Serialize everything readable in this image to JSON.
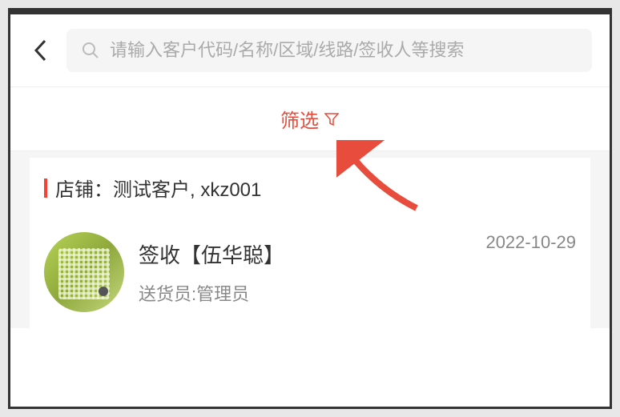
{
  "search": {
    "placeholder": "请输入客户代码/名称/区域/线路/签收人等搜索"
  },
  "filter": {
    "label": "筛选"
  },
  "store": {
    "prefix": "店铺：",
    "name": "测试客户, xkz001"
  },
  "record": {
    "title": "签收【伍华聪】",
    "deliverer_label": "送货员:",
    "deliverer_name": "管理员",
    "date": "2022-10-29"
  }
}
